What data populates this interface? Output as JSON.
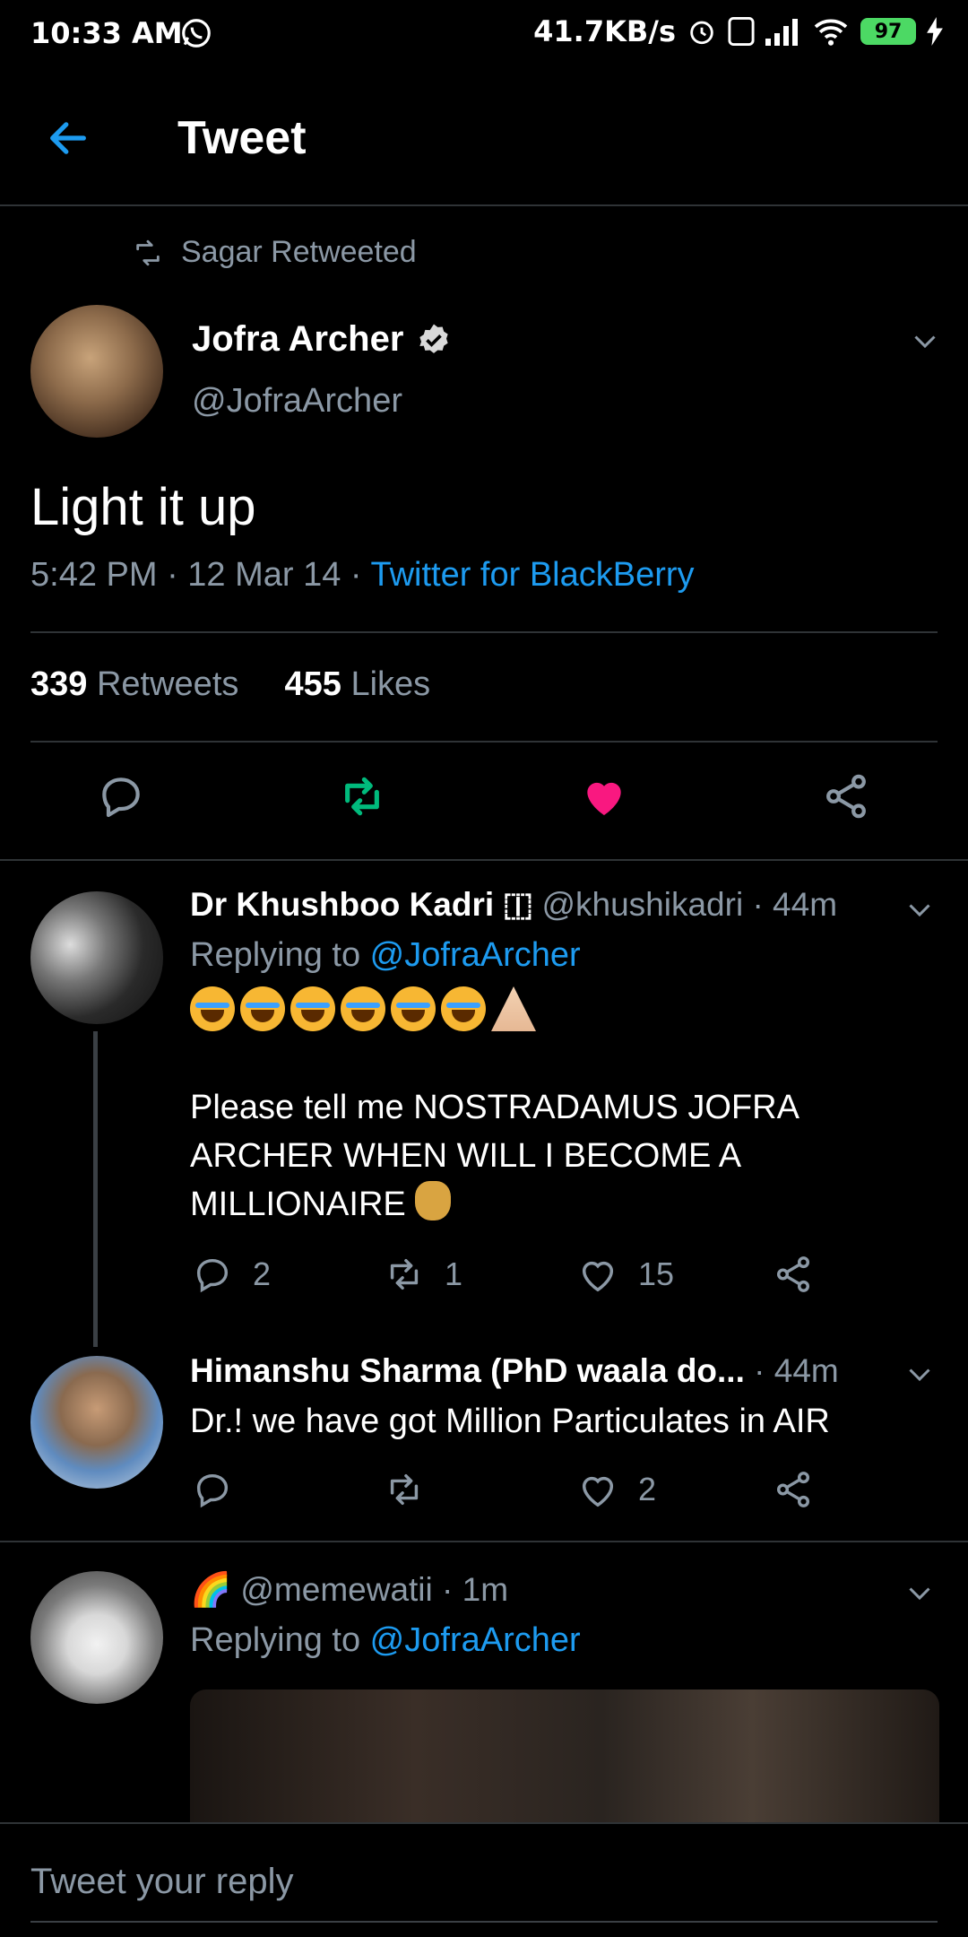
{
  "status_bar": {
    "time": "10:33 AM",
    "net_speed": "41.7KB/s",
    "battery": "97"
  },
  "header": {
    "title": "Tweet"
  },
  "tweet": {
    "retweeted_by": "Sagar Retweeted",
    "author_name": "Jofra Archer",
    "author_handle": "@JofraArcher",
    "text": "Light it up",
    "time": "5:42 PM · 12 Mar 14 · ",
    "source": "Twitter for BlackBerry",
    "retweets_count": "339",
    "retweets_label": "Retweets",
    "likes_count": "455",
    "likes_label": "Likes"
  },
  "replies": [
    {
      "name": "Dr Khushboo Kadri 🇮",
      "handle_time": "@khushikadri · 44m",
      "replying_prefix": "Replying to ",
      "replying_to": "@JofraArcher",
      "body_line1": "Please tell me NOSTRADAMUS JOFRA",
      "body_line2": "ARCHER WHEN WILL I BECOME A",
      "body_line3": "MILLIONAIRE",
      "reply_count": "2",
      "retweet_count": "1",
      "like_count": "15"
    },
    {
      "name": "Himanshu Sharma (PhD waala do...",
      "handle_time": "· 44m",
      "body": "Dr.! we have got Million Particulates in AIR",
      "like_count": "2"
    },
    {
      "name": "🌈",
      "handle_time": "@memewatii · 1m",
      "replying_prefix": "Replying to ",
      "replying_to": "@JofraArcher"
    }
  ],
  "reply_bar": {
    "placeholder": "Tweet your reply"
  },
  "colors": {
    "accent": "#1d9bf0",
    "retweet_active": "#00ba7c",
    "like_active": "#f91880",
    "background": "#000000"
  }
}
